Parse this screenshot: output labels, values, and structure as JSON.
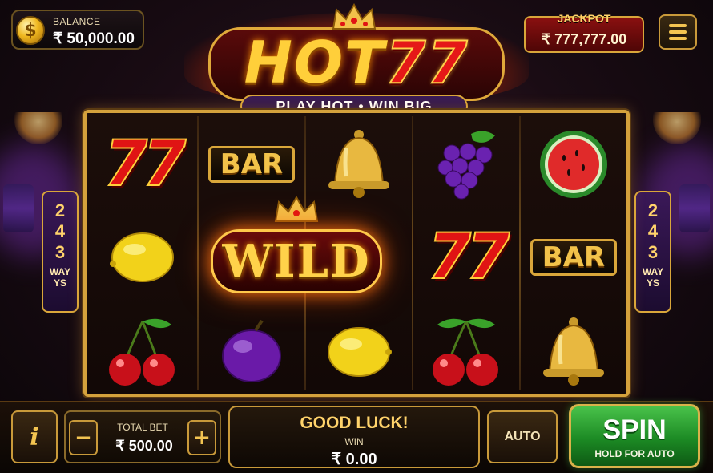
{
  "header": {
    "balance_label": "BALANCE",
    "balance_value": "₹ 50,000.00",
    "currency_icon": "rupee-coin-icon",
    "jackpot_label": "JACKPOT",
    "jackpot_value": "₹ 777,777.00",
    "menu_icon": "hamburger-menu-icon"
  },
  "logo": {
    "word_hot": "HOT",
    "word_77": "77",
    "tagline": "PLAY HOT • WIN BIG"
  },
  "reels": {
    "symbols": [
      [
        "seven",
        "lemon",
        "cherry"
      ],
      [
        "bar",
        "wild",
        "plum"
      ],
      [
        "bell",
        "wild",
        "lemon"
      ],
      [
        "grapes",
        "seven",
        "cherry"
      ],
      [
        "watermelon",
        "bar",
        "bell"
      ]
    ],
    "seven_text": "77",
    "bar_text": "BAR",
    "wild_text": "WILD"
  },
  "ways": {
    "digits": [
      "2",
      "4",
      "3"
    ],
    "word_line1": "WAY",
    "word_line2": "YS"
  },
  "controls": {
    "info_label": "i",
    "bet_label": "TOTAL BET",
    "bet_value": "₹ 500.00",
    "minus_label": "−",
    "plus_label": "+",
    "status_message": "GOOD LUCK!",
    "win_label": "WIN",
    "win_value": "₹ 0.00",
    "auto_label": "AUTO",
    "spin_label": "SPIN",
    "spin_sublabel": "HOLD FOR AUTO"
  },
  "colors": {
    "gold": "#d9a63a",
    "red": "#e01414",
    "spin_green": "#1c8a24",
    "purple_panel": "#3a1858"
  }
}
